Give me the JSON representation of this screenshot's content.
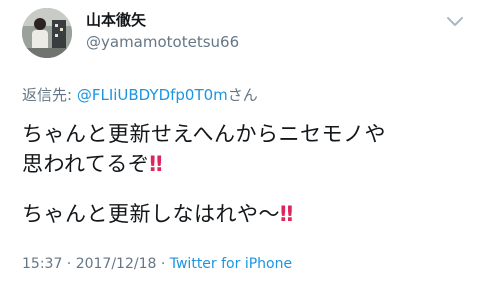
{
  "user": {
    "display_name": "山本徹矢",
    "handle": "@yamamototetsu66"
  },
  "reply": {
    "prefix": "返信先: ",
    "mention": "@FLIiUBDYDfp0T0m",
    "suffix": "さん"
  },
  "body": {
    "line1": "ちゃんと更新せえへんからニセモノや",
    "line2": "思われてるぞ",
    "line2_emoji": "‼",
    "line3": "ちゃんと更新しなはれや〜",
    "line3_emoji": "‼"
  },
  "meta": {
    "timestamp": "15:37 · 2017/12/18 · ",
    "source": "Twitter for iPhone"
  },
  "icons": {
    "menu": "chevron-down-icon",
    "emphasis": "double-exclamation-icon"
  },
  "colors": {
    "link": "#1b95e0",
    "muted": "#657786",
    "text": "#14171a",
    "emoji": "#e0245e"
  }
}
